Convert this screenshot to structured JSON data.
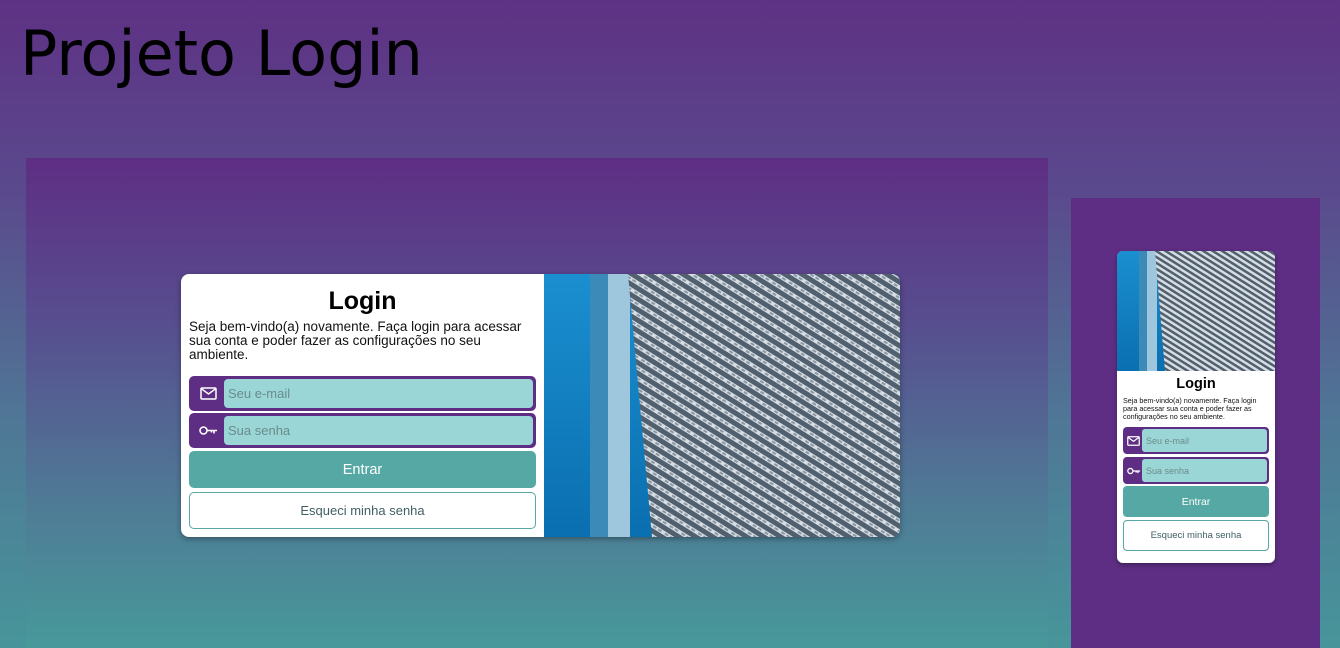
{
  "page": {
    "title": "Projeto Login"
  },
  "login": {
    "heading": "Login",
    "subtitle": "Seja bem-vindo(a) novamente. Faça login para acessar sua conta e poder fazer as configurações no seu ambiente.",
    "email_placeholder": "Seu e-mail",
    "password_placeholder": "Sua senha",
    "enter_label": "Entrar",
    "forgot_label": "Esqueci minha senha",
    "email_icon": "mail-icon",
    "password_icon": "key-icon"
  },
  "colors": {
    "purple": "#5e2e84",
    "teal": "#56a8a4",
    "input_bg": "#9ad6d6",
    "bg_gradient_top": "#5e3184",
    "bg_gradient_bottom": "#47959a"
  }
}
